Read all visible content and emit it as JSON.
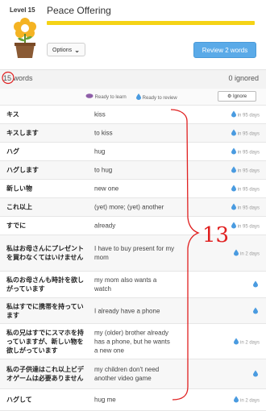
{
  "header": {
    "level": "Level 15",
    "title": "Peace Offering",
    "options_label": "Options",
    "review_label": "Review 2 words",
    "progress": 1.0
  },
  "summary": {
    "count": "15",
    "count_suffix": "words",
    "ignored": "0 ignored"
  },
  "legend": {
    "learn": "Ready to learn",
    "review": "Ready to review",
    "ignore": "Ignore"
  },
  "colors": {
    "progress": "#f5d316",
    "review_button": "#5aaae8",
    "water": "#4a9be0",
    "annotation": "#e02020"
  },
  "rows": [
    {
      "jp": "キス",
      "en": "kiss",
      "due": "in 95 days"
    },
    {
      "jp": "キスします",
      "en": "to kiss",
      "due": "in 95 days"
    },
    {
      "jp": "ハグ",
      "en": "hug",
      "due": "in 95 days"
    },
    {
      "jp": "ハグします",
      "en": "to hug",
      "due": "in 95 days"
    },
    {
      "jp": "新しい物",
      "en": "new one",
      "due": "in 95 days"
    },
    {
      "jp": "これ以上",
      "en": "(yet) more; (yet) another",
      "due": "in 95 days"
    },
    {
      "jp": "すでに",
      "en": "already",
      "due": "in 95 days"
    },
    {
      "jp": "私はお母さんにプレゼントを買わなくてはいけません",
      "en": "I have to buy present for my mom",
      "due": "in 2 days"
    },
    {
      "jp": "私のお母さんも時計を欲しがっています",
      "en": "my mom also wants a watch",
      "due": ""
    },
    {
      "jp": "私はすでに携帯を持っています",
      "en": "I already have a phone",
      "due": ""
    },
    {
      "jp": "私の兄はすでにスマホを持っていますが、新しい物を欲しがっています",
      "en": "my (older) brother already has a phone, but he wants a new one",
      "due": "in 2 days"
    },
    {
      "jp": "私の子供達はこれ以上ビデオゲームは必要ありません",
      "en": "my children don't need another video game",
      "due": ""
    },
    {
      "jp": "ハグして",
      "en": "hug me",
      "due": "in 2 days"
    }
  ],
  "annotation": {
    "text": "13"
  }
}
